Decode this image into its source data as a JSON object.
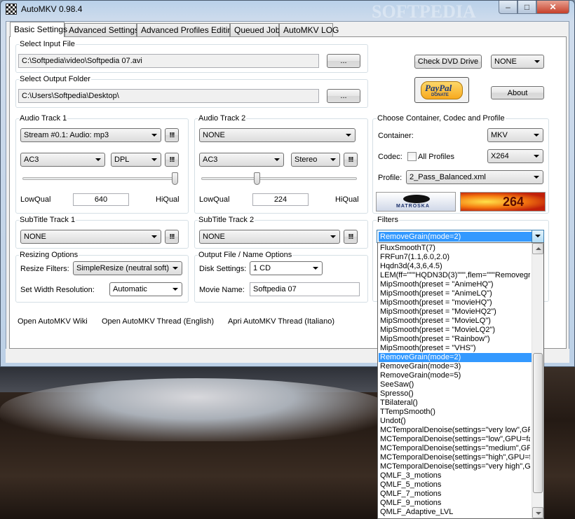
{
  "window": {
    "title": "AutoMKV 0.98.4",
    "min": "–",
    "max": "□",
    "close": "✕"
  },
  "tabs": [
    {
      "label": "Basic Settings",
      "active": true
    },
    {
      "label": "Advanced Settings",
      "active": false
    },
    {
      "label": "Advanced Profiles Editing",
      "active": false
    },
    {
      "label": "Queued Job",
      "active": false
    },
    {
      "label": "AutoMKV LOG",
      "active": false
    }
  ],
  "input_file": {
    "label": "Select Input File",
    "value": "C:\\Softpedia\\video\\Softpedia 07.avi",
    "browse": "..."
  },
  "output_folder": {
    "label": "Select Output Folder",
    "value": "C:\\Users\\Softpedia\\Desktop\\",
    "browse": "..."
  },
  "top_right": {
    "check_dvd": "Check DVD Drive",
    "drive_select": "NONE",
    "about": "About",
    "paypal": "PayPal",
    "paypal_sub": "DONATE"
  },
  "audio1": {
    "label": "Audio Track 1",
    "stream": "Stream #0.1: Audio: mp3",
    "codec": "AC3",
    "mode": "DPL",
    "excl": "!!!",
    "low": "LowQual",
    "high": "HiQual",
    "bitrate": "640",
    "slider_value": 1.0
  },
  "audio2": {
    "label": "Audio Track 2",
    "stream": "NONE",
    "codec": "AC3",
    "mode": "Stereo",
    "excl": "!!!",
    "low": "LowQual",
    "high": "HiQual",
    "bitrate": "224",
    "slider_value": 0.35
  },
  "container_box": {
    "label": "Choose Container, Codec and Profile",
    "container_label": "Container:",
    "container": "MKV",
    "codec_label": "Codec:",
    "all_profiles": "All Profiles",
    "codec": "X264",
    "profile_label": "Profile:",
    "profile": "2_Pass_Balanced.xml"
  },
  "logos": {
    "mkv": "MATROSKA",
    "x264": "264"
  },
  "subtitle1": {
    "label": "SubTitle Track 1",
    "value": "NONE",
    "excl": "!!!"
  },
  "subtitle2": {
    "label": "SubTitle Track 2",
    "value": "NONE",
    "excl": "!!!"
  },
  "filters": {
    "label": "Filters",
    "selected": "RemoveGrain(mode=2)"
  },
  "resizing": {
    "label": "Resizing Options",
    "filters_label": "Resize Filters:",
    "filter": "SimpleResize (neutral soft)",
    "width_label": "Set Width Resolution:",
    "width": "Automatic"
  },
  "output": {
    "label": "Output File / Name Options",
    "disk_label": "Disk Settings:",
    "disk": "1 CD",
    "movie_label": "Movie Name:",
    "movie": "Softpedia 07"
  },
  "links": [
    "Open AutoMKV Wiki",
    "Open AutoMKV Thread (English)",
    "Apri AutoMKV Thread (Italiano)"
  ],
  "watermark": "SOFTPEDIA",
  "filter_list": [
    "FluxSmoothT(7)",
    "FRFun7(1.1,6.0,2.0)",
    "Hqdn3d(4,3,6,4.5)",
    "LEM(ff=\"\"\"HQDN3D(3)\"\"\",flem=\"\"\"Removegra",
    "MipSmooth(preset = \"AnimeHQ\")",
    "MipSmooth(preset = \"AnimeLQ\")",
    "MipSmooth(preset = \"movieHQ\")",
    "MipSmooth(preset = \"MovieHQ2\")",
    "MipSmooth(preset = \"MovieLQ\")",
    "MipSmooth(preset = \"MovieLQ2\")",
    "MipSmooth(preset = \"Rainbow\")",
    "MipSmooth(preset = \"VHS\")",
    "RemoveGrain(mode=2)",
    "RemoveGrain(mode=3)",
    "RemoveGrain(mode=5)",
    "SeeSaw()",
    "Spresso()",
    "TBilateral()",
    "TTempSmooth()",
    "Undot()",
    "MCTemporalDenoise(settings=\"very low\",GPU",
    "MCTemporalDenoise(settings=\"low\",GPU=fal",
    "MCTemporalDenoise(settings=\"medium\",GPU",
    "MCTemporalDenoise(settings=\"high\",GPU=fa",
    "MCTemporalDenoise(settings=\"very high\",GP",
    "QMLF_3_motions",
    "QMLF_5_motions",
    "QMLF_7_motions",
    "QMLF_9_motions",
    "QMLF_Adaptive_LVL"
  ],
  "filter_list_highlight": 12
}
